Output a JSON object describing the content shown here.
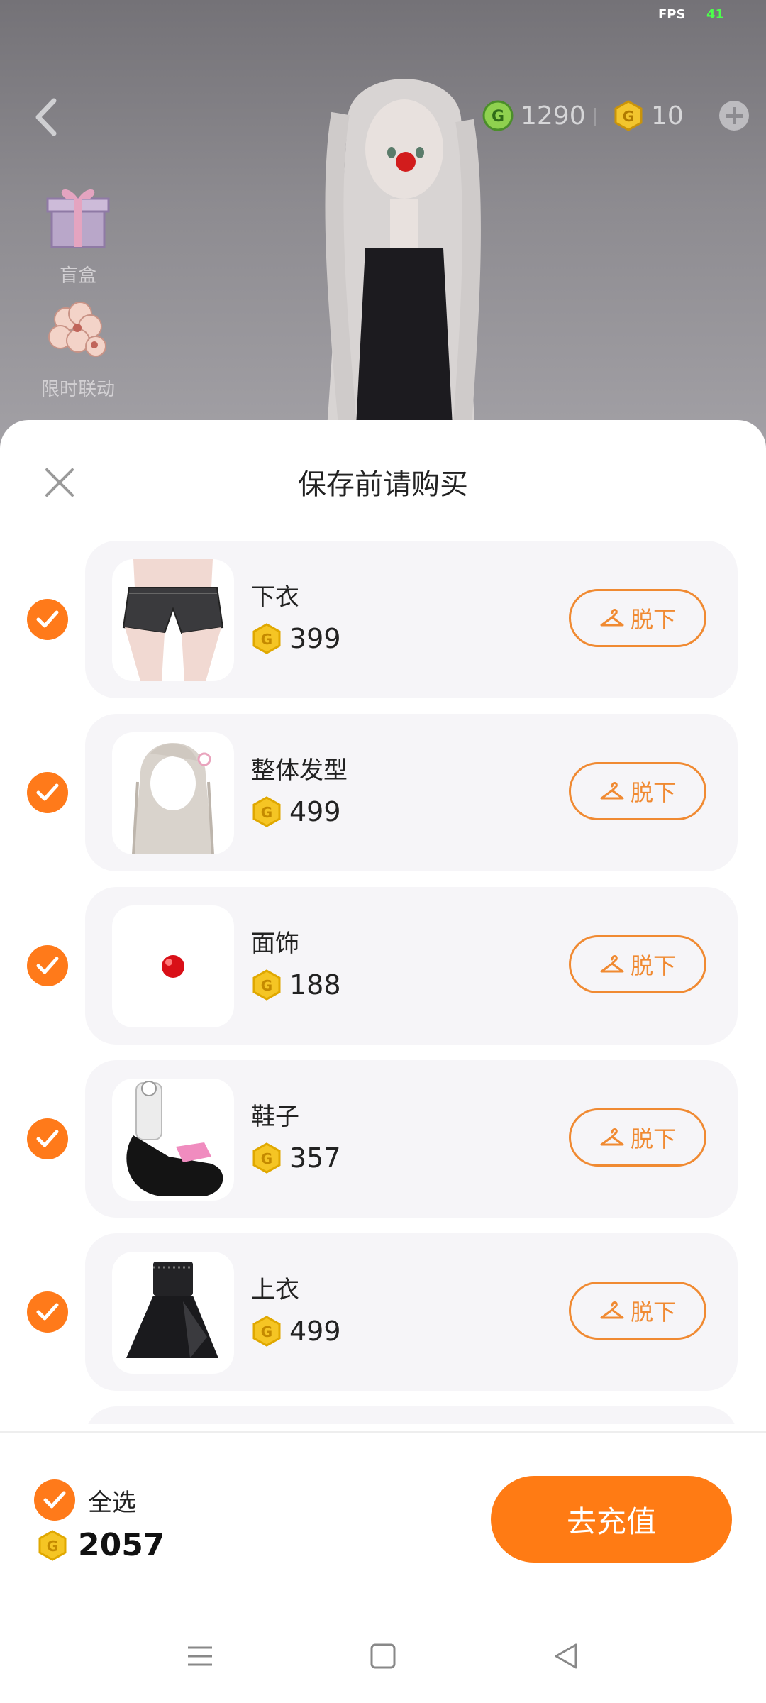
{
  "status": {
    "fps_label": "FPS",
    "fps_value": "41"
  },
  "header": {
    "green_currency": "1290",
    "gold_currency": "10"
  },
  "sidebar": {
    "items": [
      {
        "label": "盲盒",
        "icon": "gift-box-icon"
      },
      {
        "label": "限时联动",
        "icon": "flower-icon"
      }
    ]
  },
  "sheet": {
    "title": "保存前请购买",
    "remove_label": "脱下",
    "items": [
      {
        "name": "下衣",
        "price": "399",
        "checked": true,
        "icon": "shorts-icon"
      },
      {
        "name": "整体发型",
        "price": "499",
        "checked": true,
        "icon": "hair-icon"
      },
      {
        "name": "面饰",
        "price": "188",
        "checked": true,
        "icon": "red-nose-icon"
      },
      {
        "name": "鞋子",
        "price": "357",
        "checked": true,
        "icon": "shoes-icon"
      },
      {
        "name": "上衣",
        "price": "499",
        "checked": true,
        "icon": "dress-icon"
      }
    ]
  },
  "footer": {
    "select_all_label": "全选",
    "total": "2057",
    "recharge_label": "去充值"
  },
  "colors": {
    "accent": "#ff7b14",
    "outline": "#f08a32",
    "card": "#f6f5f8"
  }
}
